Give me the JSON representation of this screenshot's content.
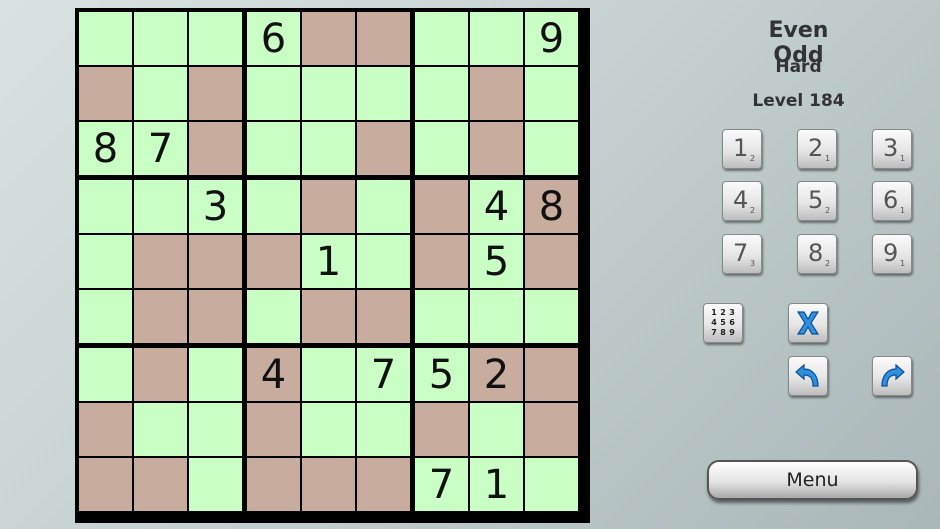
{
  "header": {
    "title": "Even Odd",
    "difficulty": "Hard",
    "level": "Level 184"
  },
  "board": {
    "colors": {
      "odd_cell": "#c9ffc4",
      "even_cell": "#c8ad9e",
      "border": "#000000"
    },
    "shading": [
      "ooooeeooo",
      "eoeooooeo",
      "ooeooeoeo",
      "ooooeoeoe",
      "oeeeooeoe",
      "oeeoeeooo",
      "oeoeoooee",
      "eooeooeoe",
      "eeoeeeooo"
    ],
    "values": [
      [
        "",
        "",
        "",
        "6",
        "",
        "",
        "",
        "",
        "9"
      ],
      [
        "",
        "",
        "",
        "",
        "",
        "",
        "",
        "",
        ""
      ],
      [
        "8",
        "7",
        "",
        "",
        "",
        "",
        "",
        "",
        ""
      ],
      [
        "",
        "",
        "3",
        "",
        "",
        "",
        "",
        "4",
        "8"
      ],
      [
        "",
        "",
        "",
        "",
        "1",
        "",
        "",
        "5",
        ""
      ],
      [
        "",
        "",
        "",
        "",
        "",
        "",
        "",
        "",
        ""
      ],
      [
        "",
        "",
        "",
        "4",
        "",
        "7",
        "5",
        "2",
        ""
      ],
      [
        "",
        "",
        "",
        "",
        "",
        "",
        "",
        "",
        ""
      ],
      [
        "",
        "",
        "",
        "",
        "",
        "",
        "7",
        "1",
        ""
      ]
    ]
  },
  "number_pad": [
    {
      "digit": "1",
      "count": "2"
    },
    {
      "digit": "2",
      "count": "1"
    },
    {
      "digit": "3",
      "count": "1"
    },
    {
      "digit": "4",
      "count": "2"
    },
    {
      "digit": "5",
      "count": "2"
    },
    {
      "digit": "6",
      "count": "1"
    },
    {
      "digit": "7",
      "count": "3"
    },
    {
      "digit": "8",
      "count": "2"
    },
    {
      "digit": "9",
      "count": "1"
    }
  ],
  "tools": {
    "notes_grid": [
      "1",
      "2",
      "3",
      "4",
      "5",
      "6",
      "7",
      "8",
      "9"
    ],
    "erase_icon": "x-icon",
    "undo_icon": "undo-arrow-icon",
    "redo_icon": "redo-arrow-icon",
    "icon_color": "#2f8fe0"
  },
  "menu_label": "Menu"
}
